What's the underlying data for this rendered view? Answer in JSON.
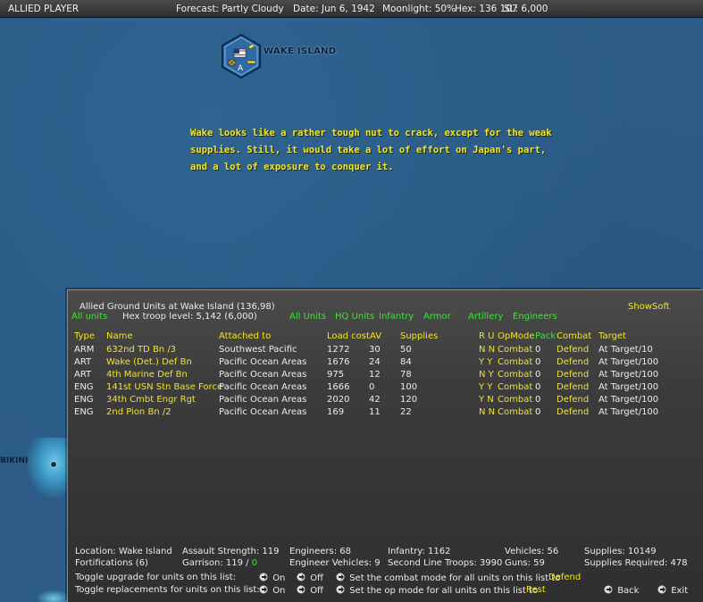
{
  "topbar": {
    "player": "ALLIED PLAYER",
    "forecast": "Forecast: Partly Cloudy",
    "date": "Date: Jun 6, 1942",
    "moonlight": "Moonlight: 50%",
    "hex": "Hex: 136 107",
    "sl": "SL: 6,000"
  },
  "map": {
    "base_name": "WAKE ISLAND",
    "base_marker": "A",
    "atoll_name": "BIKINI",
    "note": "Wake looks like a rather tough nut to crack, except for the weak supplies.  Still, it would take a lot of effort on Japan's part, and a lot of exposure to conquer it."
  },
  "panel": {
    "title": "Allied Ground Units at Wake Island  (136,98)",
    "show_soft": "ShowSoft",
    "all_units_left": "All units",
    "hex_troop": "Hex troop level: 5,142  (6,000)",
    "filters": [
      "All Units",
      "HQ Units",
      "Infantry",
      "Armor",
      "Artillery",
      "Engineers"
    ],
    "columns": {
      "type": "Type",
      "name": "Name",
      "attached": "Attached to",
      "load": "Load cost",
      "av": "AV",
      "supplies": "Supplies",
      "ru": "R U",
      "opmode": "OpMode",
      "pack": "Pack",
      "combat": "Combat",
      "target": "Target"
    },
    "units": [
      {
        "type": "ARM",
        "name": "632nd TD Bn /3",
        "attached": "Southwest Pacific",
        "load": "1272",
        "av": "30",
        "supplies": "50",
        "ru": "N N",
        "opmode": "Combat",
        "pack": "0",
        "combat": "Defend",
        "target": "At Target/10"
      },
      {
        "type": "ART",
        "name": "Wake (Det.) Def Bn",
        "attached": "Pacific Ocean Areas",
        "load": "1676",
        "av": "24",
        "supplies": "84",
        "ru": "Y Y",
        "opmode": "Combat",
        "pack": "0",
        "combat": "Defend",
        "target": "At Target/100"
      },
      {
        "type": "ART",
        "name": "4th Marine Def Bn",
        "attached": "Pacific Ocean Areas",
        "load": "975",
        "av": "12",
        "supplies": "78",
        "ru": "N Y",
        "opmode": "Combat",
        "pack": "0",
        "combat": "Defend",
        "target": "At Target/100"
      },
      {
        "type": "ENG",
        "name": "141st USN Stn Base Force",
        "attached": "Pacific Ocean Areas",
        "load": "1666",
        "av": "0",
        "supplies": "100",
        "ru": "Y Y",
        "opmode": "Combat",
        "pack": "0",
        "combat": "Defend",
        "target": "At Target/100"
      },
      {
        "type": "ENG",
        "name": "34th Cmbt Engr Rgt",
        "attached": "Pacific Ocean Areas",
        "load": "2020",
        "av": "42",
        "supplies": "120",
        "ru": "Y N",
        "opmode": "Combat",
        "pack": "0",
        "combat": "Defend",
        "target": "At Target/100"
      },
      {
        "type": "ENG",
        "name": "2nd Pion Bn /2",
        "attached": "Pacific Ocean Areas",
        "load": "169",
        "av": "11",
        "supplies": "22",
        "ru": "N N",
        "opmode": "Combat",
        "pack": "0",
        "combat": "Defend",
        "target": "At Target/100"
      }
    ],
    "summary": {
      "location": "Location: Wake Island",
      "fortifications": "Fortifications (6)",
      "assault": "Assault Strength: 119",
      "garrison_label": "Garrison: 119  /",
      "garrison_value": "0",
      "engineers": "Engineers: 68",
      "eng_vehicles": "Engineer Vehicles: 9",
      "infantry": "Infantry: 1162",
      "second_line": "Second Line Troops: 3990",
      "vehicles": "Vehicles: 56",
      "guns": "Guns: 59",
      "supplies": "Supplies: 10149",
      "supplies_req": "Supplies Required: 478"
    },
    "toggles": {
      "upgrade_label": "Toggle upgrade for units on this list:",
      "replace_label": "Toggle replacements for units on this list:",
      "on": "On",
      "off": "Off",
      "combat_mode_label": "Set the combat mode for all units on this list to",
      "combat_mode_value": "Defend",
      "op_mode_label": "Set the op mode for all units on this list to",
      "op_mode_value": "Rest",
      "back": "Back",
      "exit": "Exit"
    }
  },
  "colors": {
    "ocean": "#2b5b86",
    "panel": "#3c3c3c",
    "yellow": "#f2e42a",
    "green": "#3fe03f"
  }
}
